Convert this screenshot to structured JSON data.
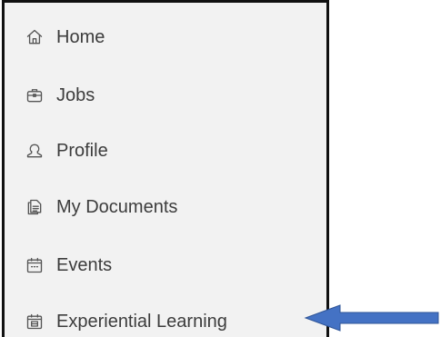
{
  "sidebar": {
    "items": [
      {
        "label": "Home",
        "icon": "home-icon"
      },
      {
        "label": "Jobs",
        "icon": "briefcase-icon"
      },
      {
        "label": "Profile",
        "icon": "user-icon"
      },
      {
        "label": "My Documents",
        "icon": "documents-icon"
      },
      {
        "label": "Events",
        "icon": "calendar-icon"
      },
      {
        "label": "Experiential Learning",
        "icon": "calendar-check-icon"
      }
    ]
  },
  "annotation": {
    "arrow_color": "#4472c4",
    "points_to": "Experiential Learning"
  },
  "colors": {
    "sidebar_bg": "#f2f2f2",
    "border": "#111111",
    "text": "#3c3c3c",
    "icon": "#555555"
  }
}
